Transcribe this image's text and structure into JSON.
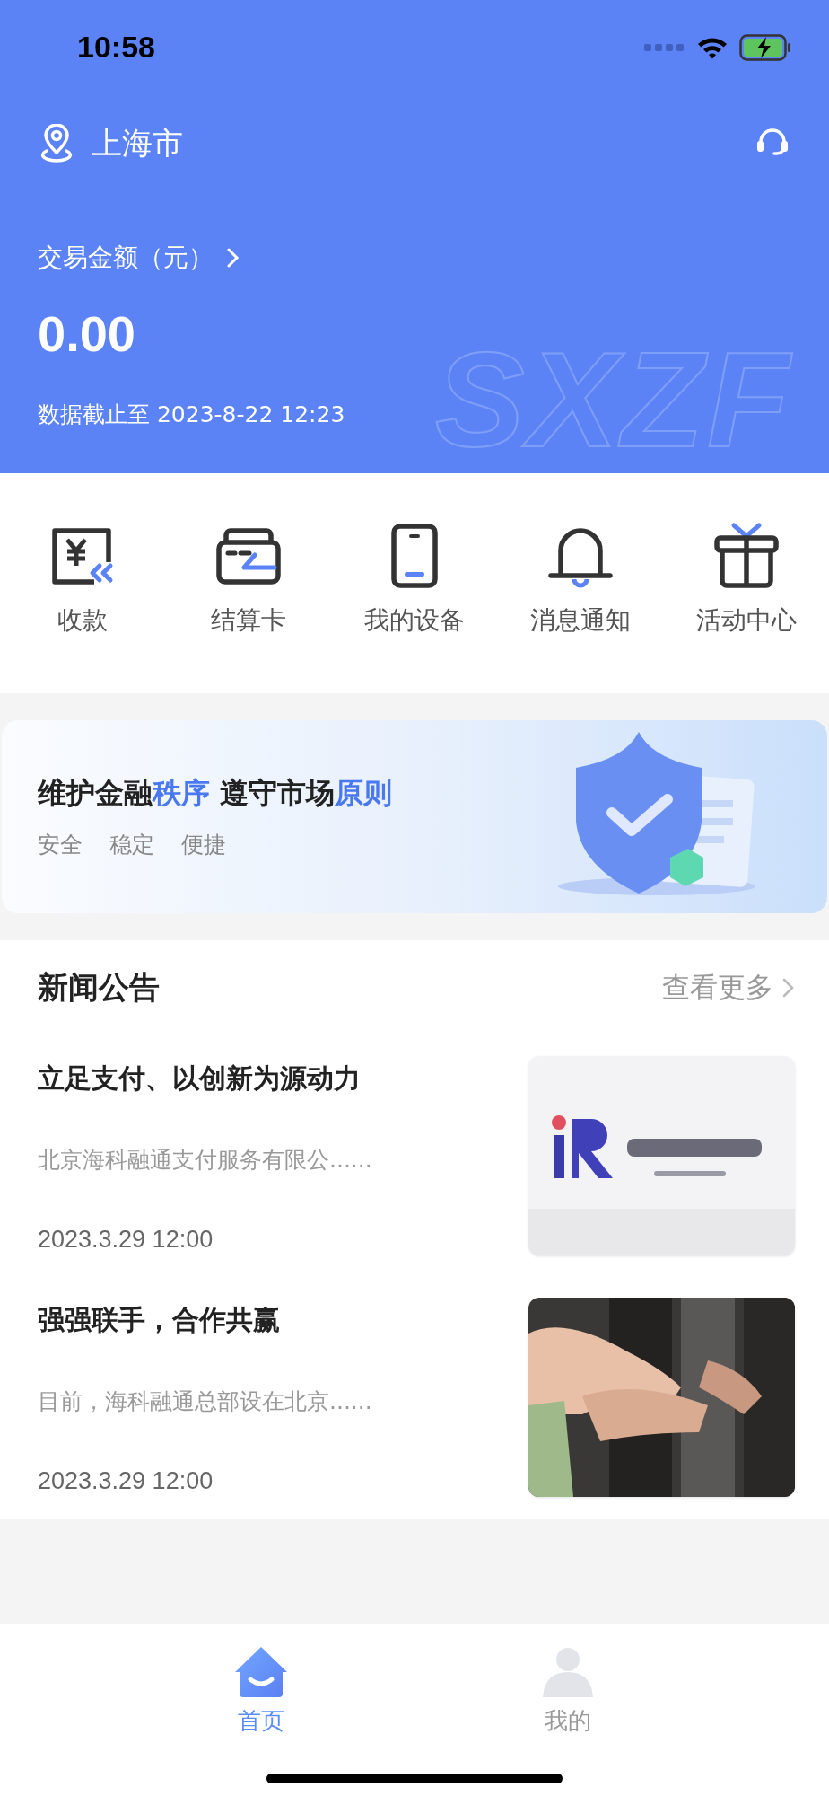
{
  "status_bar": {
    "time": "10:58"
  },
  "header": {
    "city": "上海市",
    "amount_label": "交易金额（元）",
    "amount": "0.00",
    "updated": "数据截止至 2023-8-22 12:23",
    "brand_mark": "SXZF"
  },
  "shortcuts": [
    {
      "label": "收款",
      "kind": "receive"
    },
    {
      "label": "结算卡",
      "kind": "card"
    },
    {
      "label": "我的设备",
      "kind": "device"
    },
    {
      "label": "消息通知",
      "kind": "bell"
    },
    {
      "label": "活动中心",
      "kind": "gift"
    }
  ],
  "banner": {
    "title": [
      {
        "text": "维护金融",
        "highlight": false
      },
      {
        "text": "秩序",
        "highlight": true
      },
      {
        "text": " 遵守市场",
        "highlight": false
      },
      {
        "text": "原则",
        "highlight": true
      }
    ],
    "tags": [
      "安全",
      "稳定",
      "便捷"
    ]
  },
  "news": {
    "title": "新闻公告",
    "more": "查看更多",
    "items": [
      {
        "title": "立足支付、以创新为源动力",
        "summary": "北京海科融通支付服务有限公......",
        "date": "2023.3.29 12:00"
      },
      {
        "title": "强强联手，合作共赢",
        "summary": "目前，海科融通总部设在北京......",
        "date": "2023.3.29 12:00"
      }
    ]
  },
  "tab_bar": {
    "tabs": [
      {
        "label": "首页",
        "selected": true,
        "kind": "home"
      },
      {
        "label": "我的",
        "selected": false,
        "kind": "profile"
      }
    ]
  }
}
